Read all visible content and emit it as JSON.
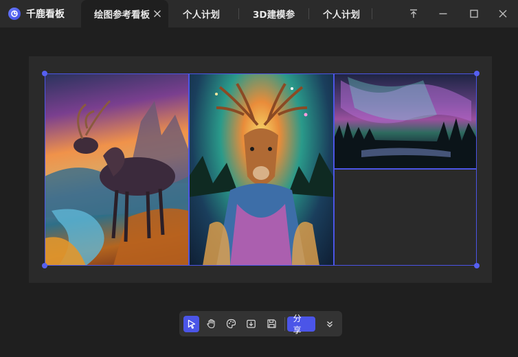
{
  "app": {
    "name": "千鹿看板"
  },
  "tabs": [
    {
      "label": "绘图参考看板",
      "active": true
    },
    {
      "label": "个人计划",
      "active": false
    },
    {
      "label": "3D建模参",
      "active": false
    },
    {
      "label": "个人计划",
      "active": false
    }
  ],
  "window_controls": [
    "pin-icon",
    "minimize-icon",
    "maximize-icon",
    "close-icon"
  ],
  "board": {
    "images": [
      {
        "name": "deer-mountain-river-painting"
      },
      {
        "name": "deer-portrait-neon-painting"
      },
      {
        "name": "aurora-forest-painting"
      }
    ]
  },
  "toolbar": {
    "tools": [
      "select-icon",
      "hand-icon",
      "palette-icon",
      "import-icon",
      "save-icon"
    ],
    "share_label": "分享",
    "more_icon": "chevron-double-down-icon"
  },
  "colors": {
    "accent": "#4b55e8",
    "titlebar": "#2b2b2b",
    "background": "#1f1f1f",
    "canvas": "#2a2a2a",
    "selection": "#4c55e6"
  }
}
